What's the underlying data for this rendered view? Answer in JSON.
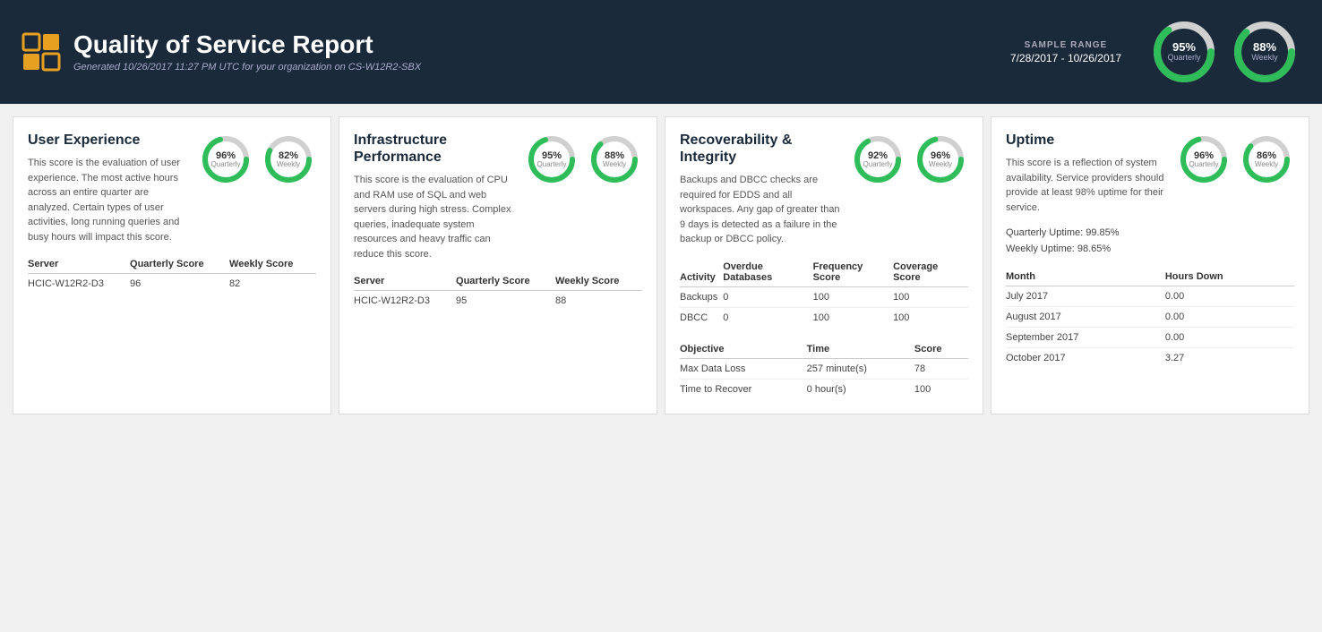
{
  "header": {
    "title": "Quality of Service Report",
    "subtitle": "Generated 10/26/2017 11:27 PM UTC for your organization on CS-W12R2-SBX",
    "sample_range_label": "SAMPLE RANGE",
    "sample_range_dates": "7/28/2017 - 10/26/2017",
    "quarterly_pct": "95%",
    "quarterly_label": "Quarterly",
    "weekly_pct": "88%",
    "weekly_label": "Weekly"
  },
  "user_experience": {
    "title": "User Experience",
    "desc": "This score is the evaluation of user experience. The most active hours across an entire quarter are analyzed. Certain types of user activities, long running queries and busy hours will impact this score.",
    "quarterly_pct": "96%",
    "quarterly_label": "Quarterly",
    "weekly_pct": "82%",
    "weekly_label": "Weekly",
    "table": {
      "col1": "Server",
      "col2": "Quarterly Score",
      "col3": "Weekly Score",
      "rows": [
        {
          "server": "HCIC-W12R2-D3",
          "quarterly": "96",
          "weekly": "82"
        }
      ]
    }
  },
  "infrastructure": {
    "title": "Infrastructure Performance",
    "desc": "This score is the evaluation of CPU and RAM use of SQL and web servers during high stress. Complex queries, inadequate system resources and heavy traffic can reduce this score.",
    "quarterly_pct": "95%",
    "quarterly_label": "Quarterly",
    "weekly_pct": "88%",
    "weekly_label": "Weekly",
    "table": {
      "col1": "Server",
      "col2": "Quarterly Score",
      "col3": "Weekly Score",
      "rows": [
        {
          "server": "HCIC-W12R2-D3",
          "quarterly": "95",
          "weekly": "88"
        }
      ]
    }
  },
  "recoverability": {
    "title": "Recoverability & Integrity",
    "desc": "Backups and DBCC checks are required for EDDS and all workspaces. Any gap of greater than 9 days is detected as a failure in the backup or DBCC policy.",
    "quarterly_pct": "92%",
    "quarterly_label": "Quarterly",
    "weekly_pct": "96%",
    "weekly_label": "Weekly",
    "table1": {
      "col1": "Activity",
      "col2": "Overdue Databases",
      "col3": "Frequency Score",
      "col4": "Coverage Score",
      "rows": [
        {
          "activity": "Backups",
          "overdue": "0",
          "frequency": "100",
          "coverage": "100"
        },
        {
          "activity": "DBCC",
          "overdue": "0",
          "frequency": "100",
          "coverage": "100"
        }
      ]
    },
    "table2": {
      "col1": "Objective",
      "col2": "Time",
      "col3": "Score",
      "rows": [
        {
          "objective": "Max Data Loss",
          "time": "257 minute(s)",
          "score": "78"
        },
        {
          "objective": "Time to Recover",
          "time": "0 hour(s)",
          "score": "100"
        }
      ]
    }
  },
  "uptime": {
    "title": "Uptime",
    "desc": "This score is a reflection of system availability. Service providers should provide at least 98% uptime for their service.",
    "quarterly_pct": "96%",
    "quarterly_label": "Quarterly",
    "weekly_pct": "86%",
    "weekly_label": "Weekly",
    "quarterly_uptime": "Quarterly Uptime: 99.85%",
    "weekly_uptime": "Weekly Uptime: 98.65%",
    "table": {
      "col1": "Month",
      "col2": "Hours Down",
      "rows": [
        {
          "month": "July 2017",
          "hours": "0.00"
        },
        {
          "month": "August 2017",
          "hours": "0.00"
        },
        {
          "month": "September 2017",
          "hours": "0.00"
        },
        {
          "month": "October 2017",
          "hours": "3.27"
        }
      ]
    }
  },
  "colors": {
    "green": "#2ebd59",
    "dark_navy": "#1a2a3a",
    "gray_track": "#d0d0d0",
    "accent_orange": "#e8a020"
  }
}
